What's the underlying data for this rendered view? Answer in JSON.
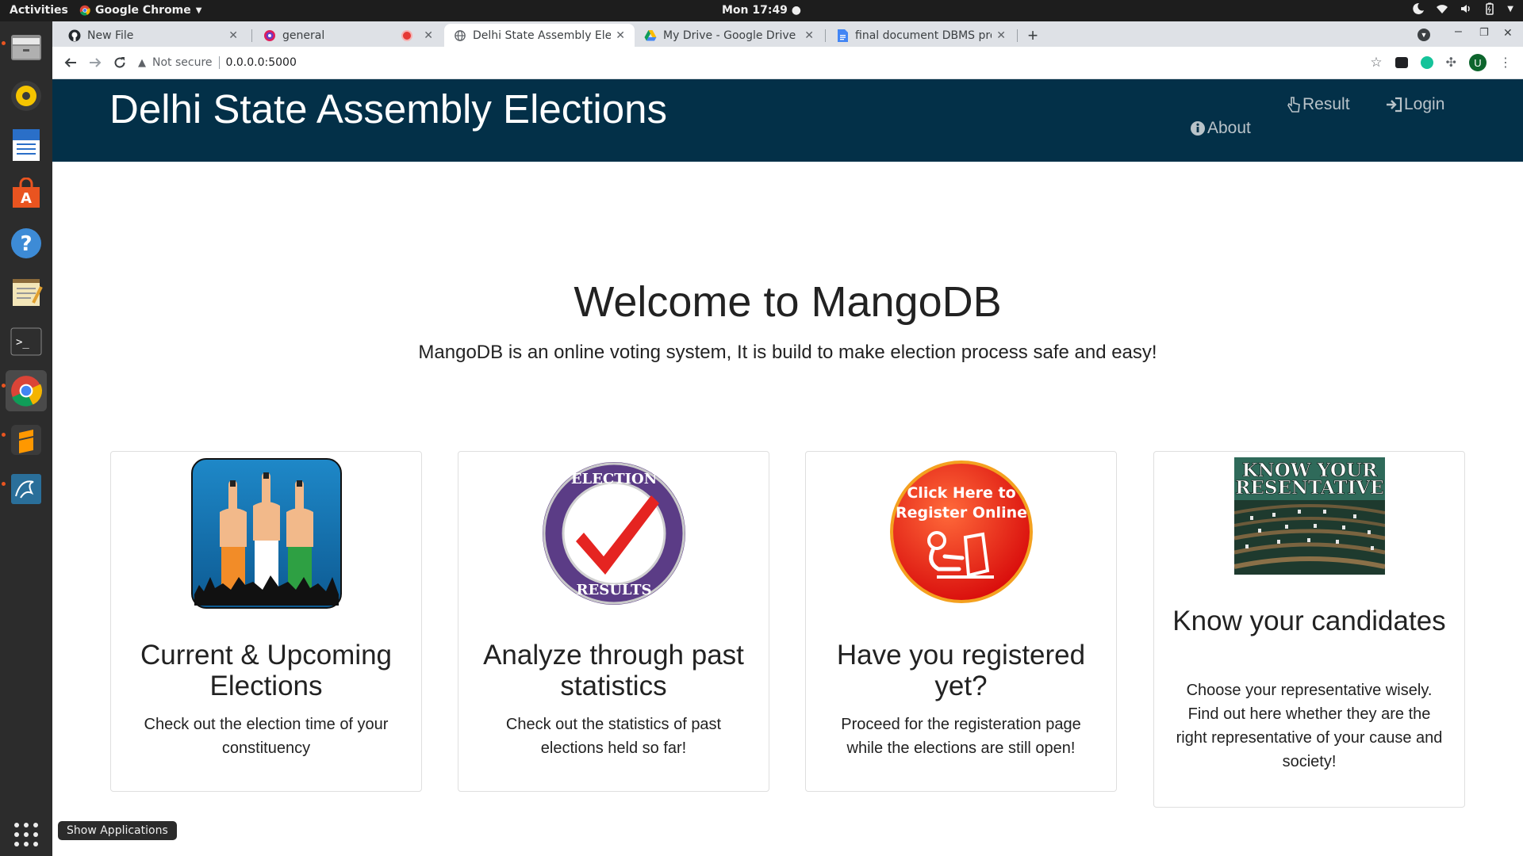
{
  "system": {
    "activities": "Activities",
    "app_menu": "Google Chrome",
    "clock": "Mon 17:49",
    "show_apps_tooltip": "Show Applications"
  },
  "browser": {
    "tabs": [
      {
        "title": "New File",
        "icon": "github-icon"
      },
      {
        "title": "general",
        "icon": "chat-icon"
      },
      {
        "title": "Delhi State Assembly Elec",
        "icon": "globe-icon"
      },
      {
        "title": "My Drive - Google Drive",
        "icon": "drive-icon"
      },
      {
        "title": "final document DBMS pro",
        "icon": "docs-icon"
      }
    ],
    "security_label": "Not secure",
    "url": "0.0.0.0:5000",
    "profile_initial": "U"
  },
  "site": {
    "brand": "Delhi State Assembly Elections",
    "nav": {
      "result": "Result",
      "login": "Login",
      "about": "About"
    }
  },
  "hero": {
    "title": "Welcome to MangoDB",
    "subtitle": "MangoDB is an online voting system, It is build to make election process safe and easy!"
  },
  "cards": [
    {
      "title": "Current & Upcoming Elections",
      "text": "Check out the election time of your constituency"
    },
    {
      "title": "Analyze through past statistics",
      "text": "Check out the statistics of past elections held so far!",
      "badge_top": "ELECTION",
      "badge_bottom": "RESULTS"
    },
    {
      "title": "Have you registered yet?",
      "text": "Proceed for the registeration page while the elections are still open!",
      "badge_line1": "Click Here to",
      "badge_line2": "Register Online"
    },
    {
      "title": "Know your candidates",
      "text": "Choose your representative wisely. Find out here whether they are the right representative of your cause and society!",
      "banner_text": "KNOW YOUR RESENTATIVE"
    }
  ]
}
